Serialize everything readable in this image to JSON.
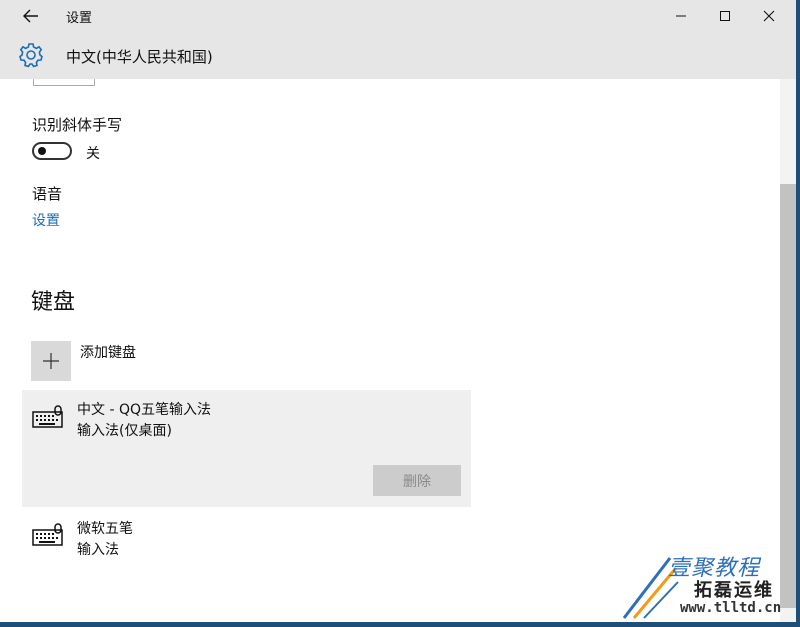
{
  "window": {
    "title": "设置"
  },
  "header": {
    "title": "中文(中华人民共和国)",
    "icon": "gear-icon"
  },
  "handwriting": {
    "label": "识别斜体手写",
    "toggle_state": "关",
    "toggle_on": false
  },
  "speech": {
    "label": "语音",
    "link": "设置"
  },
  "keyboard": {
    "section_title": "键盘",
    "add_label": "添加键盘",
    "items": [
      {
        "name": "中文 - QQ五笔输入法",
        "subtitle": "输入法(仅桌面)",
        "remove_label": "删除",
        "selected": true
      },
      {
        "name": "微软五笔",
        "subtitle": "输入法",
        "selected": false
      }
    ]
  },
  "watermark": {
    "line1": "壹聚教程",
    "line2": "拓磊运维",
    "line3": "www.tlltd.cn"
  },
  "colors": {
    "accent": "#1a6fb3",
    "titlebar": "#e6e6e6",
    "selected_item": "#efefef",
    "button_disabled": "#cccccc"
  }
}
